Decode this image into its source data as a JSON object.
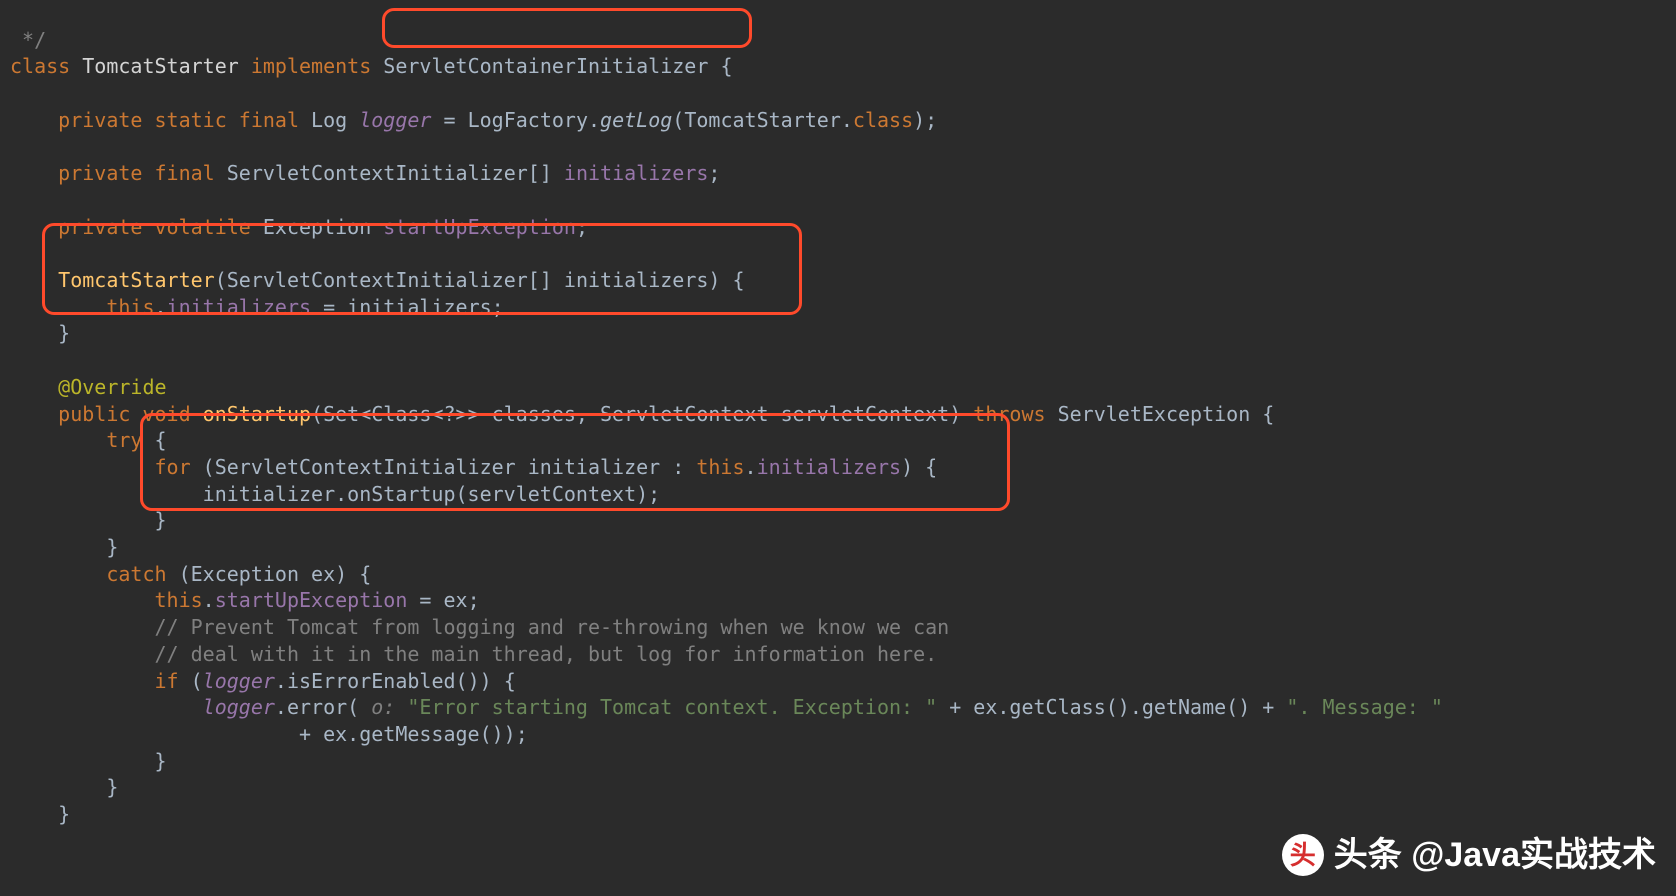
{
  "code": {
    "l0": " */",
    "l1a": "class ",
    "l1b": "TomcatStarter ",
    "l1c": "implements ",
    "l1d": "ServletContainerInitializer ",
    "l1e": "{",
    "l2": "",
    "l3a": "    private static final ",
    "l3b": "Log ",
    "l3c": "logger",
    "l3d": " = LogFactory.",
    "l3e": "getLog",
    "l3f": "(TomcatStarter.",
    "l3g": "class",
    "l3h": ");",
    "l4": "",
    "l5a": "    private final ",
    "l5b": "ServletContextInitializer[] ",
    "l5c": "initializers",
    "l5d": ";",
    "l6": "",
    "l7a": "    private volatile ",
    "l7b": "Exception ",
    "l7c": "startUpException",
    "l7d": ";",
    "l8": "",
    "l9a": "    ",
    "l9b": "TomcatStarter",
    "l9c": "(ServletContextInitializer[] initializers) {",
    "l10a": "        this",
    "l10b": ".",
    "l10c": "initializers",
    "l10d": " = initializers;",
    "l11": "    }",
    "l12": "",
    "l13a": "    ",
    "l13b": "@Override",
    "l14a": "    public void ",
    "l14b": "onStartup",
    "l14c": "(Set<Class<?>> classes, ServletContext servletContext) ",
    "l14d": "throws ",
    "l14e": "ServletException {",
    "l15a": "        try ",
    "l15b": "{",
    "l16a": "            for ",
    "l16b": "(ServletContextInitializer initializer : ",
    "l16c": "this",
    "l16d": ".",
    "l16e": "initializers",
    "l16f": ") {",
    "l17": "                initializer.onStartup(servletContext);",
    "l18": "            }",
    "l19": "        }",
    "l20a": "        catch ",
    "l20b": "(Exception ex) {",
    "l21a": "            this",
    "l21b": ".",
    "l21c": "startUpException",
    "l21d": " = ex;",
    "l22": "            // Prevent Tomcat from logging and re-throwing when we know we can",
    "l23": "            // deal with it in the main thread, but log for information here.",
    "l24a": "            if ",
    "l24b": "(",
    "l24c": "logger",
    "l24d": ".isErrorEnabled()) {",
    "l25a": "                ",
    "l25b": "logger",
    "l25c": ".error( ",
    "l25d": "o: ",
    "l25e": "\"Error starting Tomcat context. Exception: \"",
    "l25f": " + ex.getClass().getName() + ",
    "l25g": "\". Message: \"",
    "l26a": "                        + ex.getMessage());",
    "l27": "            }",
    "l28": "        }",
    "l29": "    }"
  },
  "watermark": {
    "logo_text": "头",
    "label": "头条 @Java实战技术"
  }
}
